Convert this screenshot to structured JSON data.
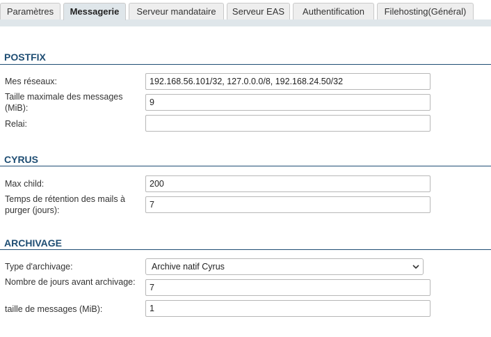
{
  "tabs": [
    {
      "label": "Paramètres",
      "active": false
    },
    {
      "label": "Messagerie",
      "active": true
    },
    {
      "label": "Serveur mandataire",
      "active": false
    },
    {
      "label": "Serveur EAS",
      "active": false
    },
    {
      "label": "Authentification",
      "active": false
    },
    {
      "label": "Filehosting(Général)",
      "active": false
    }
  ],
  "postfix": {
    "title": "POSTFIX",
    "networks_label": "Mes réseaux:",
    "networks_value": "192.168.56.101/32, 127.0.0.0/8, 192.168.24.50/32",
    "maxsize_label": "Taille maximale des messages (MiB):",
    "maxsize_value": "9",
    "relay_label": "Relai:",
    "relay_value": ""
  },
  "cyrus": {
    "title": "CYRUS",
    "maxchild_label": "Max child:",
    "maxchild_value": "200",
    "retention_label": "Temps de rétention des mails à purger (jours):",
    "retention_value": "7"
  },
  "archivage": {
    "title": "ARCHIVAGE",
    "type_label": "Type d'archivage:",
    "type_value": "Archive natif Cyrus",
    "days_label": "Nombre de jours avant archivage:",
    "days_value": "7",
    "size_label": "taille de messages (MiB):",
    "size_value": "1"
  },
  "colors": {
    "section_title": "#1e4d73",
    "tab_active_bg": "#dfe6ea",
    "tab_bg": "#eeeeee"
  }
}
